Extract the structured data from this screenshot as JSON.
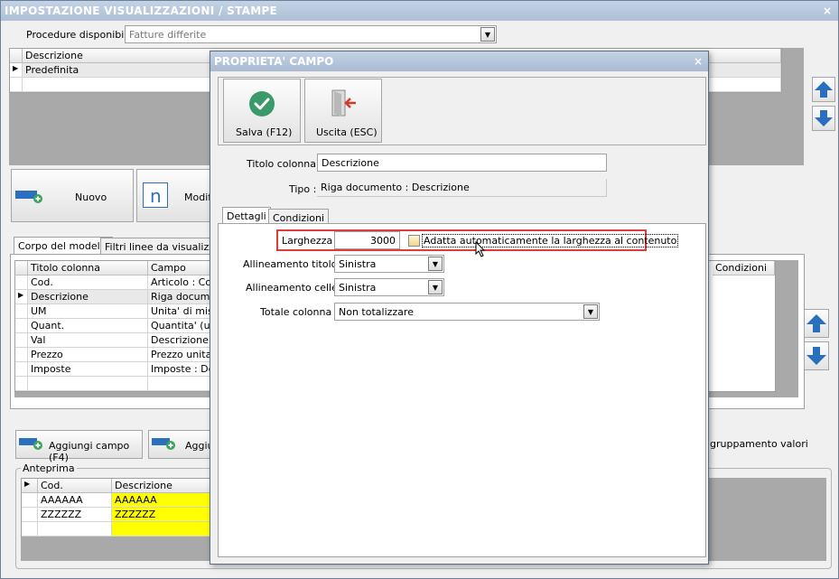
{
  "window": {
    "title": "IMPOSTAZIONE VISUALIZZAZIONI / STAMPE",
    "close": "×"
  },
  "procedures": {
    "label": "Procedure disponibili :",
    "value": "Fatture differite"
  },
  "models_grid": {
    "header": "Descrizione",
    "rows": [
      "Predefinita"
    ]
  },
  "buttons": {
    "new": "Nuovo",
    "modify": "Modifi",
    "add_field": "Aggiungi campo (F4)",
    "add_other": "Aggiu"
  },
  "tabs": {
    "body": "Corpo del modello",
    "filters": "Filtri linee da visualizzare"
  },
  "fields_grid": {
    "headers": {
      "title": "Titolo colonna",
      "field": "Campo",
      "conditions": "Condizioni"
    },
    "rows": [
      {
        "title": "Cod.",
        "field": "Articolo : Codi"
      },
      {
        "title": "Descrizione",
        "field": "Riga documen"
      },
      {
        "title": "UM",
        "field": "Unita' di misur"
      },
      {
        "title": "Quant.",
        "field": "Quantita' (uni"
      },
      {
        "title": "Val",
        "field": "Descrizione div"
      },
      {
        "title": "Prezzo",
        "field": "Prezzo unitari"
      },
      {
        "title": "Imposte",
        "field": "Imposte : Des"
      }
    ]
  },
  "grouping_label": "gruppamento valori",
  "preview": {
    "label": "Anteprima",
    "headers": {
      "code": "Cod.",
      "description": "Descrizione"
    },
    "rows": [
      {
        "code": "AAAAAA",
        "description": "AAAAAA"
      },
      {
        "code": "ZZZZZZ",
        "description": "ZZZZZZ"
      }
    ],
    "highlight_color": "#ffff00"
  },
  "dialog": {
    "title": "PROPRIETA' CAMPO",
    "close": "×",
    "save_label": "Salva (F12)",
    "exit_label": "Uscita (ESC)",
    "title_col_label": "Titolo colonna :",
    "title_col_value": "Descrizione",
    "type_label": "Tipo :",
    "type_value": "Riga documento : Descrizione",
    "tabs": {
      "details": "Dettagli",
      "conditions": "Condizioni"
    },
    "width_label": "Larghezza :",
    "width_value": "3000",
    "autofit_label": "Adatta automaticamente la larghezza al contenuto",
    "align_title_label": "Allineamento titolo :",
    "align_title_value": "Sinistra",
    "align_cells_label": "Allineamento celle :",
    "align_cells_value": "Sinistra",
    "total_label": "Totale colonna :",
    "total_value": "Non totalizzare",
    "highlight_color": "#e03c3c",
    "save_icon_color": "#3a9a6a"
  }
}
